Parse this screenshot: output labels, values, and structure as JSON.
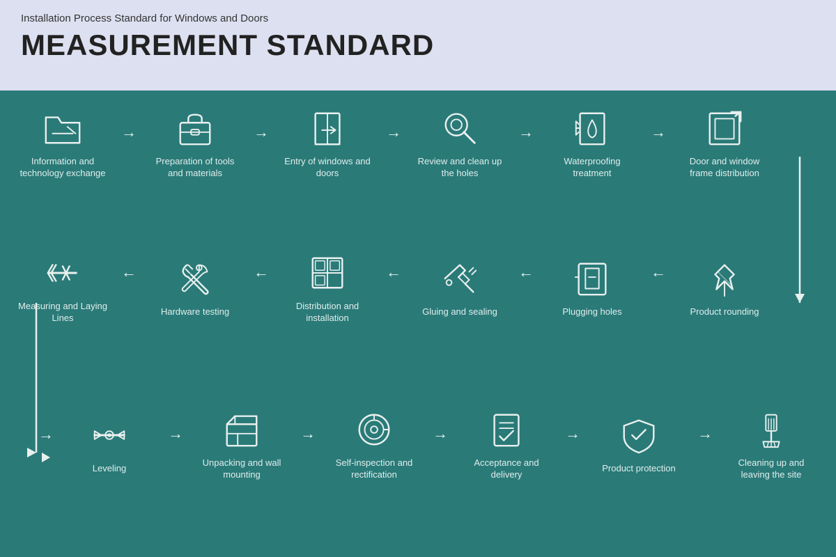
{
  "header": {
    "subtitle": "Installation Process Standard for Windows and Doors",
    "title": "MEASUREMENT STANDARD"
  },
  "rows": [
    {
      "id": "row1",
      "direction": "ltr",
      "steps": [
        {
          "id": "info-exchange",
          "label": "Information and technology exchange",
          "icon": "folder"
        },
        {
          "id": "tools-prep",
          "label": "Preparation of tools and materials",
          "icon": "toolbox"
        },
        {
          "id": "entry-windows",
          "label": "Entry of windows and doors",
          "icon": "door-enter"
        },
        {
          "id": "review-holes",
          "label": "Review and clean up the holes",
          "icon": "magnify"
        },
        {
          "id": "waterproofing",
          "label": "Waterproofing treatment",
          "icon": "waterproof"
        },
        {
          "id": "frame-dist",
          "label": "Door and window frame distribution",
          "icon": "frame-out"
        }
      ]
    },
    {
      "id": "row2",
      "direction": "rtl",
      "steps": [
        {
          "id": "measuring",
          "label": "Measuring and Laying Lines",
          "icon": "measure"
        },
        {
          "id": "hardware",
          "label": "Hardware testing",
          "icon": "wrench"
        },
        {
          "id": "distribution",
          "label": "Distribution and installation",
          "icon": "grid-install"
        },
        {
          "id": "gluing",
          "label": "Gluing and sealing",
          "icon": "glue"
        },
        {
          "id": "plugging",
          "label": "Plugging holes",
          "icon": "plug-hole"
        },
        {
          "id": "rounding",
          "label": "Product rounding",
          "icon": "pin"
        }
      ]
    },
    {
      "id": "row3",
      "direction": "ltr",
      "steps": [
        {
          "id": "leveling",
          "label": "Leveling",
          "icon": "level"
        },
        {
          "id": "unpacking",
          "label": "Unpacking and wall mounting",
          "icon": "unpack"
        },
        {
          "id": "self-inspect",
          "label": "Self-inspection and rectification",
          "icon": "self-inspect"
        },
        {
          "id": "acceptance",
          "label": "Acceptance and delivery",
          "icon": "accept"
        },
        {
          "id": "protection",
          "label": "Product protection",
          "icon": "shield"
        },
        {
          "id": "cleanup",
          "label": "Cleaning up and leaving the site",
          "icon": "cleanup"
        }
      ]
    }
  ],
  "colors": {
    "header_bg": "#dde0f0",
    "main_bg": "#2a7a78",
    "icon_stroke": "#e8f0ee",
    "text": "#e0eeec"
  }
}
